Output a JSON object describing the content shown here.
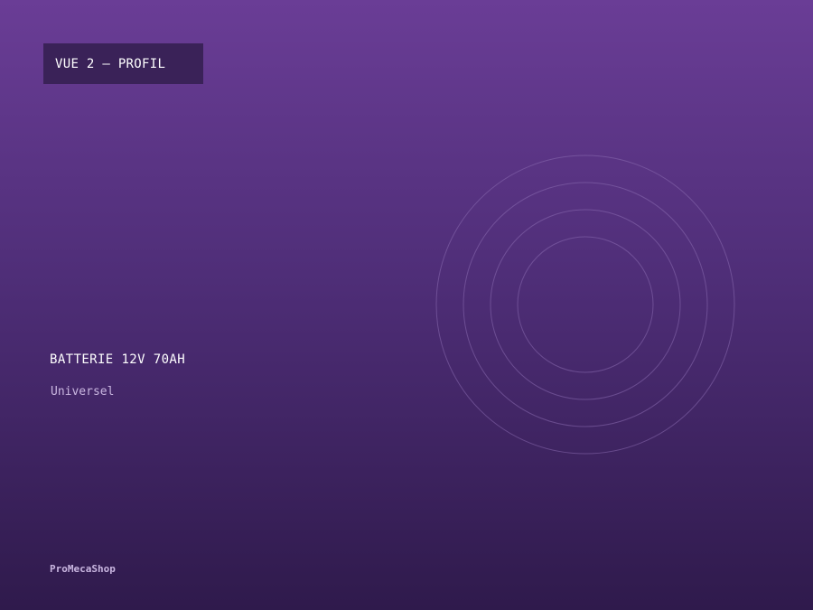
{
  "badge": {
    "label": "VUE 2 — PROFIL"
  },
  "product": {
    "title": "BATTERIE 12V 70AH",
    "subtitle": "Universel"
  },
  "brand": {
    "name": "ProMecaShop"
  },
  "decoration": {
    "icon": "concentric-rings-icon",
    "ring_color": "#8a6bb0"
  },
  "colors": {
    "background_top": "#6a3d96",
    "background_bottom": "#2f1a4c",
    "badge_background": "#3a2258",
    "muted_text": "#c9b6e0"
  }
}
